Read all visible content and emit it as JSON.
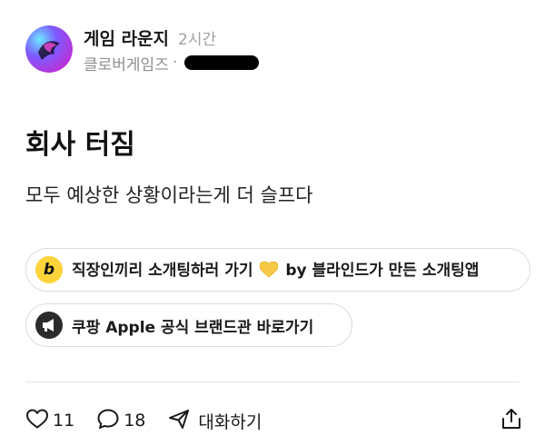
{
  "post": {
    "channel": "게임 라운지",
    "time": "2시간",
    "company": "클로버게임즈",
    "separator": "·",
    "title": "회사 터짐",
    "body": "모두 예상한 상황이라는게 더 슬프다"
  },
  "ads": [
    {
      "icon": "blind-b-logo",
      "icon_letter": "b",
      "text_before": "직장인끼리 소개팅하러 가기",
      "emoji": "yellow-heart",
      "text_after": "by 블라인드가 만든 소개팅앱"
    },
    {
      "icon": "megaphone-icon",
      "text": "쿠팡 Apple 공식 브랜드관 바로가기"
    }
  ],
  "footer": {
    "likes": "11",
    "comments": "18",
    "chat_label": "대화하기"
  },
  "colors": {
    "ad_blind_bg": "#ffd43b",
    "ad_dark_bg": "#2b2b2b",
    "muted_text": "#8e8e8e",
    "heart_yellow": "#f7c948"
  }
}
